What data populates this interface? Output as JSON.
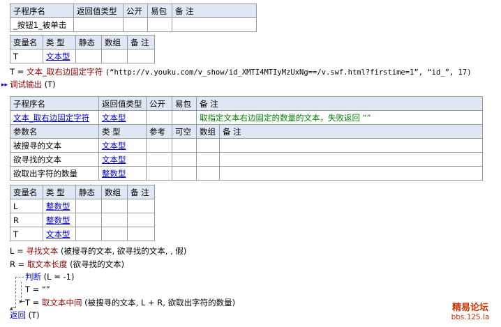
{
  "sub1": {
    "headers": [
      "子程序名",
      "返回值类型",
      "公开",
      "易包",
      "备 注"
    ],
    "row": [
      "_按钮1_被单击",
      "",
      "",
      "",
      ""
    ]
  },
  "vars1": {
    "headers": [
      "变量名",
      "类 型",
      "静态",
      "数组",
      "备 注"
    ],
    "row": [
      "T",
      "文本型",
      "",
      "",
      ""
    ]
  },
  "code1": {
    "lhs": "T = ",
    "func": "文本_取右边固定字符",
    "args": "(“http://v.youku.com/v_show/id_XMTI4MTIyMzUxNg==/v.swf.html?firstime=1”, “id_”, 17)"
  },
  "code2": {
    "func": "调试输出",
    "args": "(T)"
  },
  "sub2": {
    "headers": [
      "子程序名",
      "返回值类型",
      "公开",
      "易包",
      "备 注"
    ],
    "row": [
      "文本_取右边固定字符",
      "文本型",
      "",
      "",
      "取指定文本右边固定的数量的文本，失败返回 “”"
    ],
    "param_headers": [
      "参数名",
      "类 型",
      "参考",
      "可空",
      "数组",
      "备 注"
    ],
    "params": [
      [
        "被搜寻的文本",
        "文本型"
      ],
      [
        "欲寻找的文本",
        "文本型"
      ],
      [
        "欲取出字符的数量",
        "整数型"
      ]
    ]
  },
  "vars2": {
    "headers": [
      "变量名",
      "类 型",
      "静态",
      "数组",
      "备 注"
    ],
    "rows": [
      [
        "L",
        "整数型"
      ],
      [
        "R",
        "整数型"
      ],
      [
        "T",
        "文本型"
      ]
    ]
  },
  "code3": {
    "l1_lhs": "L = ",
    "l1_func": "寻找文本",
    "l1_args": "(被搜寻的文本, 欲寻找的文本, , 假)",
    "l2_lhs": "R = ",
    "l2_func": "取文本长度",
    "l2_args": "(欲寻找的文本)",
    "l3_func": "判断",
    "l3_args": "(L = -1)",
    "l4": "T = “”",
    "l5_lhs": "T = ",
    "l5_func": "取文本中间",
    "l5_args": "(被搜寻的文本, L + R, 欲取出字符的数量)",
    "l6_func": "返回",
    "l6_args": "(T)"
  },
  "watermark": {
    "line1": "精易论坛",
    "line2": "bbs.125.la"
  }
}
